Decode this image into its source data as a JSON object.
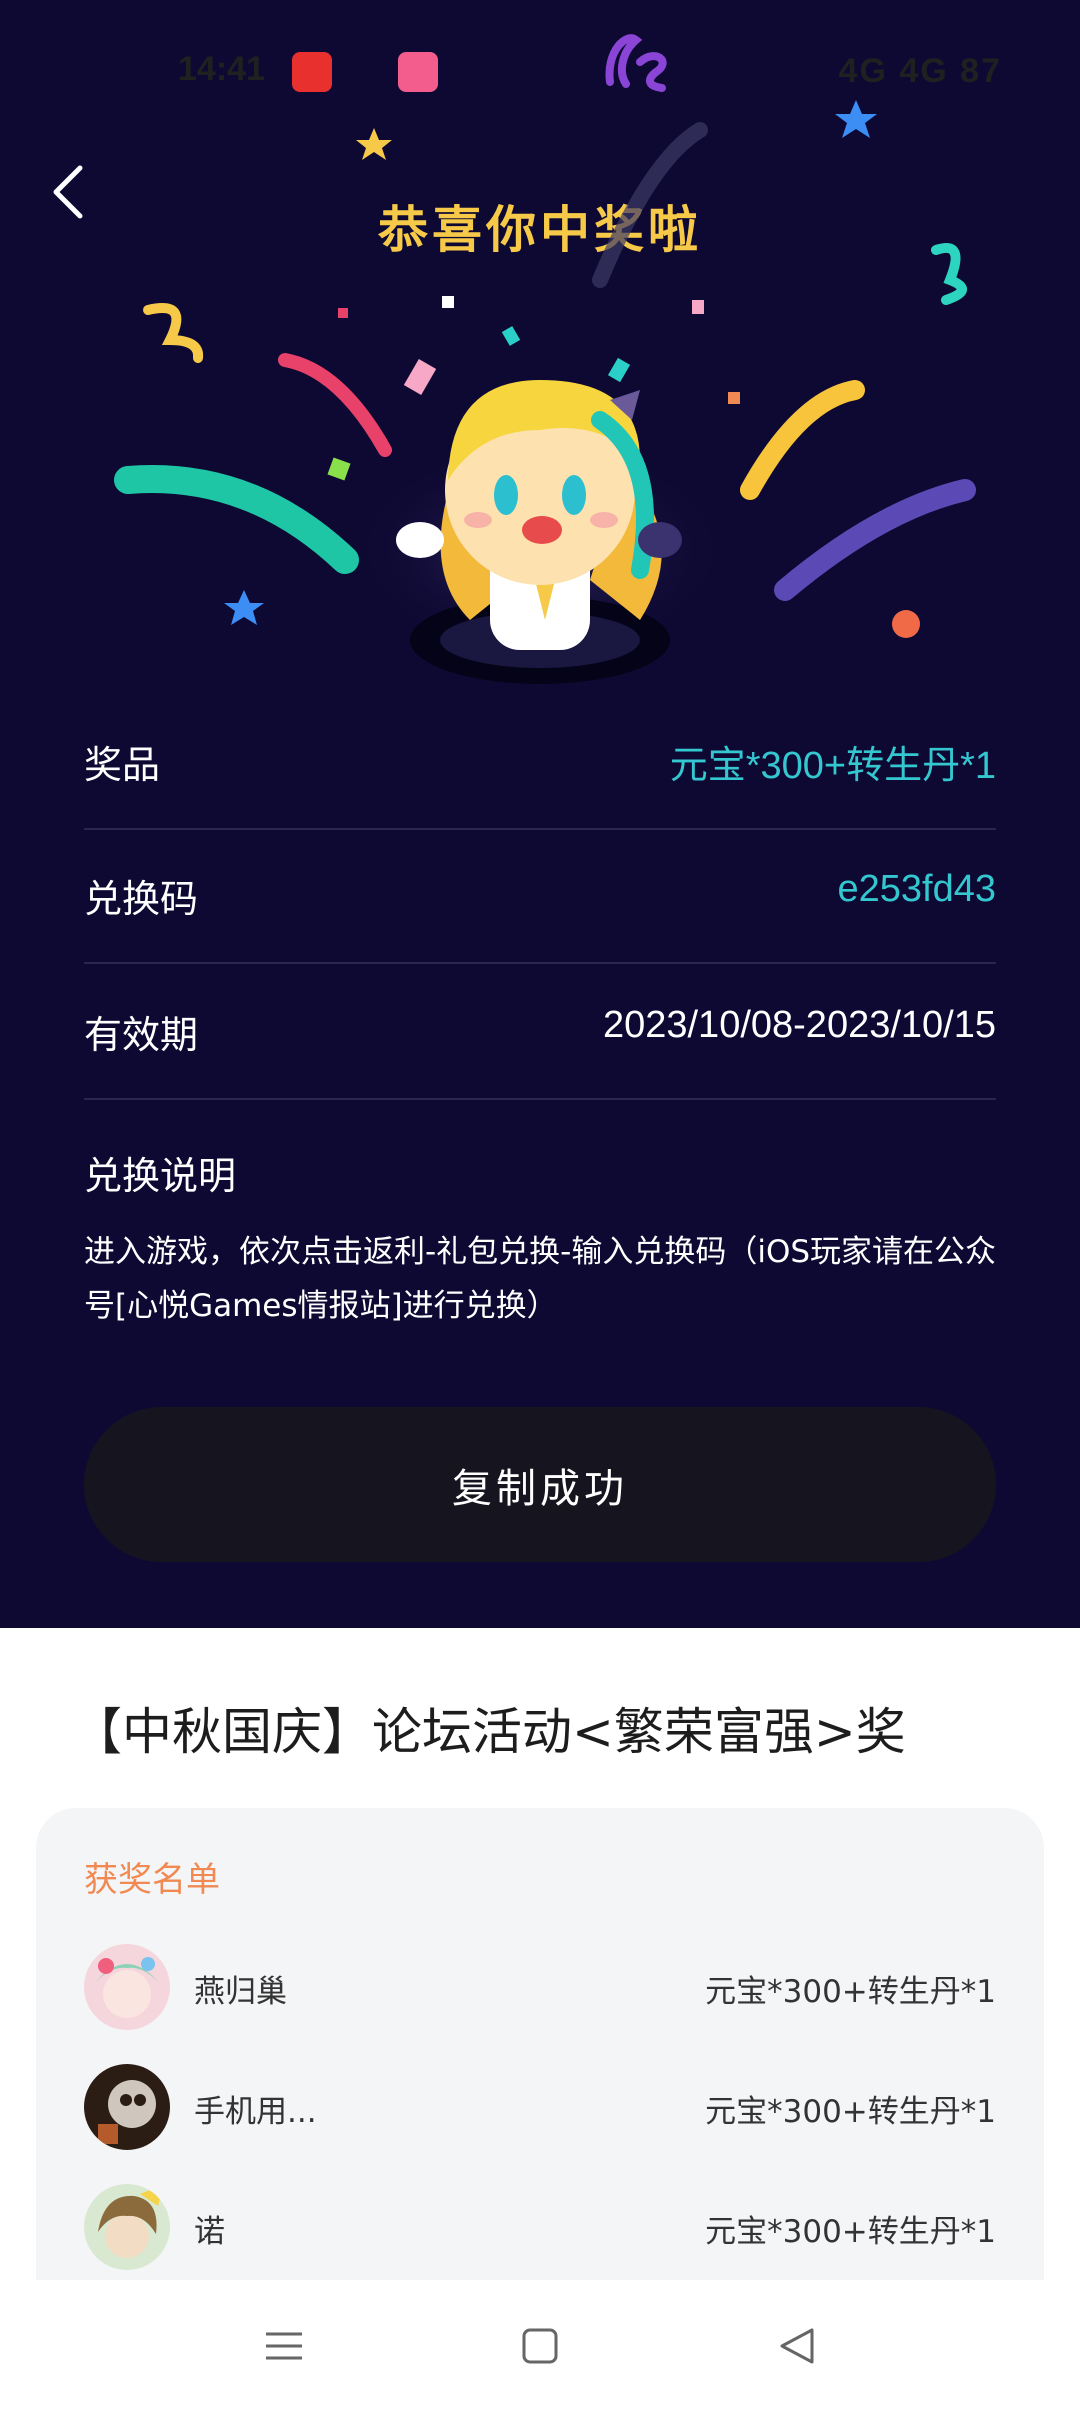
{
  "status_bar": {
    "time": "14:41",
    "right_text": "4G 4G 87"
  },
  "header": {
    "title": "恭喜你中奖啦"
  },
  "reward": {
    "rows": [
      {
        "label": "奖品",
        "value": "元宝*300+转生丹*1"
      },
      {
        "label": "兑换码",
        "value": "e253fd43"
      },
      {
        "label": "有效期",
        "value": "2023/10/08-2023/10/15"
      }
    ],
    "instructions_title": "兑换说明",
    "instructions_text": "进入游戏，依次点击返利-礼包兑换-输入兑换码（iOS玩家请在公众号[心悦Games情报站]进行兑换）",
    "copy_button": "复制成功"
  },
  "event": {
    "title": "【中秋国庆】论坛活动<繁荣富强>奖"
  },
  "winners": {
    "title": "获奖名单",
    "list": [
      {
        "name": "燕归巢",
        "prize": "元宝*300+转生丹*1"
      },
      {
        "name": "手机用...",
        "prize": "元宝*300+转生丹*1"
      },
      {
        "name": "诺",
        "prize": "元宝*300+转生丹*1"
      }
    ]
  },
  "colors": {
    "hero_background": "#0d0933",
    "title_gold": "#f7c948",
    "accent_teal": "#35c7d0",
    "winners_title_orange": "#f08a52"
  }
}
